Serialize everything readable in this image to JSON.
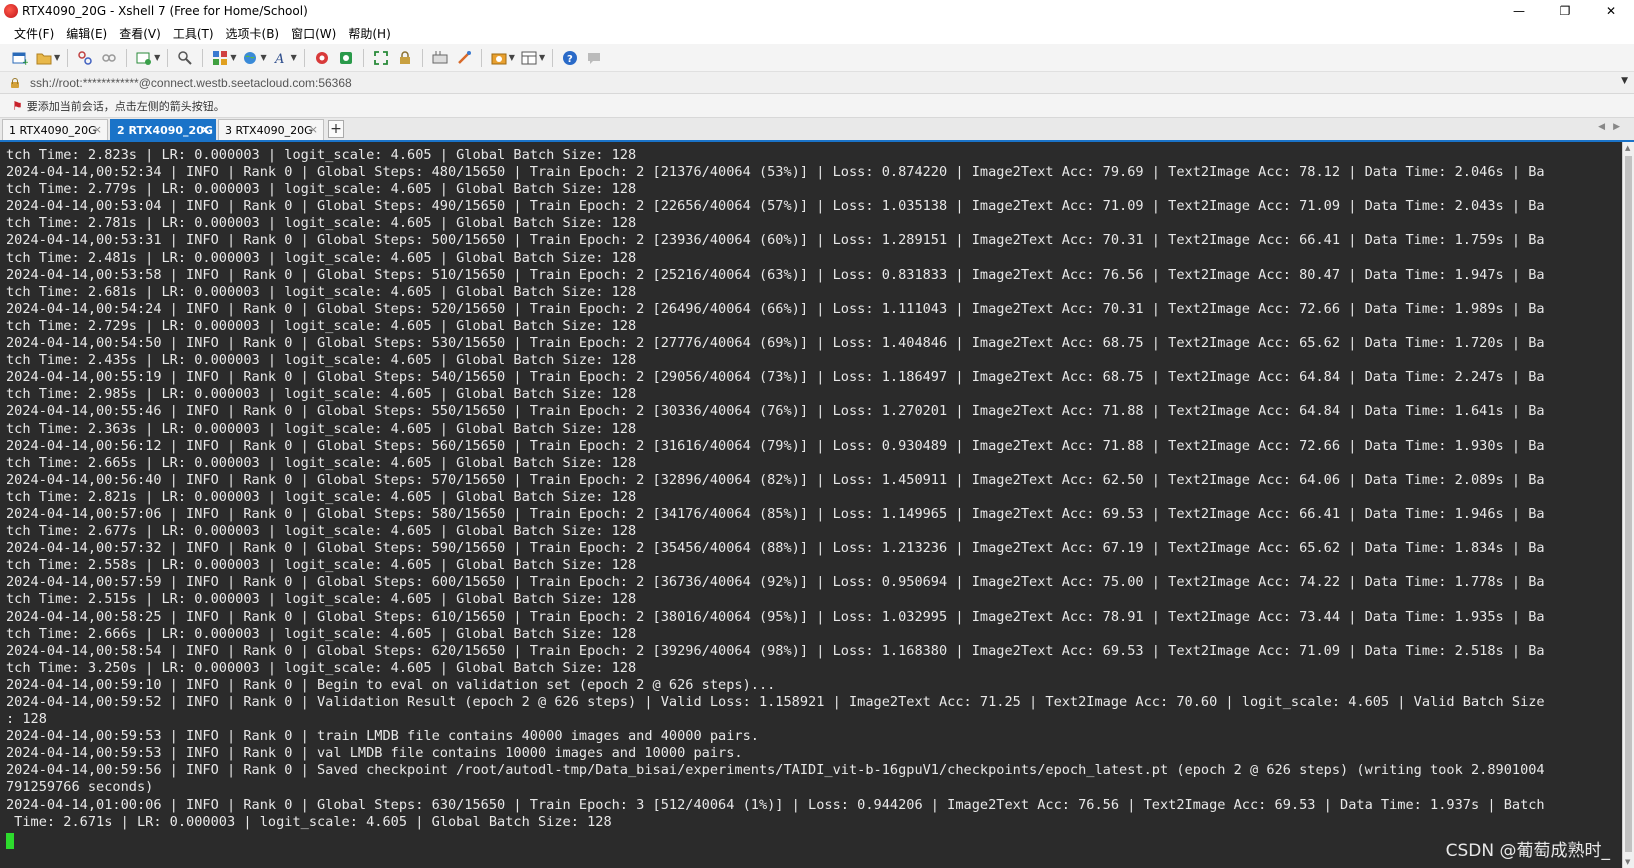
{
  "window": {
    "title": "RTX4090_20G - Xshell 7 (Free for Home/School)",
    "minimize": "—",
    "maximize": "❐",
    "close": "✕"
  },
  "menu": [
    "文件(F)",
    "编辑(E)",
    "查看(V)",
    "工具(T)",
    "选项卡(B)",
    "窗口(W)",
    "帮助(H)"
  ],
  "toolbar": {
    "icons": [
      "new-session-icon",
      "open-folder-icon",
      "connect-icon",
      "disconnect-icon",
      "reconnect-icon",
      "find-icon",
      "sessions-manager-icon",
      "globe-icon",
      "font-icon",
      "xftp-icon",
      "xmanager-icon",
      "fullscreen-icon",
      "lock-icon",
      "keyboard-icon",
      "script-icon",
      "capture-icon",
      "layout-icon",
      "help-icon",
      "chat-icon"
    ]
  },
  "address": {
    "url": "ssh://root:************@connect.westb.seetacloud.com:56368"
  },
  "hint": {
    "text": "要添加当前会话，点击左侧的箭头按钮。"
  },
  "tabs": [
    {
      "label": "1 RTX4090_20G",
      "close": "×"
    },
    {
      "label": "2 RTX4090_20G",
      "close": "×"
    },
    {
      "label": "3 RTX4090_20G",
      "close": "×"
    }
  ],
  "tab_add": "+",
  "terminal": {
    "lines": [
      "tch Time: 2.823s | LR: 0.000003 | logit_scale: 4.605 | Global Batch Size: 128",
      "2024-04-14,00:52:34 | INFO | Rank 0 | Global Steps: 480/15650 | Train Epoch: 2 [21376/40064 (53%)] | Loss: 0.874220 | Image2Text Acc: 79.69 | Text2Image Acc: 78.12 | Data Time: 2.046s | Ba",
      "tch Time: 2.779s | LR: 0.000003 | logit_scale: 4.605 | Global Batch Size: 128",
      "2024-04-14,00:53:04 | INFO | Rank 0 | Global Steps: 490/15650 | Train Epoch: 2 [22656/40064 (57%)] | Loss: 1.035138 | Image2Text Acc: 71.09 | Text2Image Acc: 71.09 | Data Time: 2.043s | Ba",
      "tch Time: 2.781s | LR: 0.000003 | logit_scale: 4.605 | Global Batch Size: 128",
      "2024-04-14,00:53:31 | INFO | Rank 0 | Global Steps: 500/15650 | Train Epoch: 2 [23936/40064 (60%)] | Loss: 1.289151 | Image2Text Acc: 70.31 | Text2Image Acc: 66.41 | Data Time: 1.759s | Ba",
      "tch Time: 2.481s | LR: 0.000003 | logit_scale: 4.605 | Global Batch Size: 128",
      "2024-04-14,00:53:58 | INFO | Rank 0 | Global Steps: 510/15650 | Train Epoch: 2 [25216/40064 (63%)] | Loss: 0.831833 | Image2Text Acc: 76.56 | Text2Image Acc: 80.47 | Data Time: 1.947s | Ba",
      "tch Time: 2.681s | LR: 0.000003 | logit_scale: 4.605 | Global Batch Size: 128",
      "2024-04-14,00:54:24 | INFO | Rank 0 | Global Steps: 520/15650 | Train Epoch: 2 [26496/40064 (66%)] | Loss: 1.111043 | Image2Text Acc: 70.31 | Text2Image Acc: 72.66 | Data Time: 1.989s | Ba",
      "tch Time: 2.729s | LR: 0.000003 | logit_scale: 4.605 | Global Batch Size: 128",
      "2024-04-14,00:54:50 | INFO | Rank 0 | Global Steps: 530/15650 | Train Epoch: 2 [27776/40064 (69%)] | Loss: 1.404846 | Image2Text Acc: 68.75 | Text2Image Acc: 65.62 | Data Time: 1.720s | Ba",
      "tch Time: 2.435s | LR: 0.000003 | logit_scale: 4.605 | Global Batch Size: 128",
      "2024-04-14,00:55:19 | INFO | Rank 0 | Global Steps: 540/15650 | Train Epoch: 2 [29056/40064 (73%)] | Loss: 1.186497 | Image2Text Acc: 68.75 | Text2Image Acc: 64.84 | Data Time: 2.247s | Ba",
      "tch Time: 2.985s | LR: 0.000003 | logit_scale: 4.605 | Global Batch Size: 128",
      "2024-04-14,00:55:46 | INFO | Rank 0 | Global Steps: 550/15650 | Train Epoch: 2 [30336/40064 (76%)] | Loss: 1.270201 | Image2Text Acc: 71.88 | Text2Image Acc: 64.84 | Data Time: 1.641s | Ba",
      "tch Time: 2.363s | LR: 0.000003 | logit_scale: 4.605 | Global Batch Size: 128",
      "2024-04-14,00:56:12 | INFO | Rank 0 | Global Steps: 560/15650 | Train Epoch: 2 [31616/40064 (79%)] | Loss: 0.930489 | Image2Text Acc: 71.88 | Text2Image Acc: 72.66 | Data Time: 1.930s | Ba",
      "tch Time: 2.665s | LR: 0.000003 | logit_scale: 4.605 | Global Batch Size: 128",
      "2024-04-14,00:56:40 | INFO | Rank 0 | Global Steps: 570/15650 | Train Epoch: 2 [32896/40064 (82%)] | Loss: 1.450911 | Image2Text Acc: 62.50 | Text2Image Acc: 64.06 | Data Time: 2.089s | Ba",
      "tch Time: 2.821s | LR: 0.000003 | logit_scale: 4.605 | Global Batch Size: 128",
      "2024-04-14,00:57:06 | INFO | Rank 0 | Global Steps: 580/15650 | Train Epoch: 2 [34176/40064 (85%)] | Loss: 1.149965 | Image2Text Acc: 69.53 | Text2Image Acc: 66.41 | Data Time: 1.946s | Ba",
      "tch Time: 2.677s | LR: 0.000003 | logit_scale: 4.605 | Global Batch Size: 128",
      "2024-04-14,00:57:32 | INFO | Rank 0 | Global Steps: 590/15650 | Train Epoch: 2 [35456/40064 (88%)] | Loss: 1.213236 | Image2Text Acc: 67.19 | Text2Image Acc: 65.62 | Data Time: 1.834s | Ba",
      "tch Time: 2.558s | LR: 0.000003 | logit_scale: 4.605 | Global Batch Size: 128",
      "2024-04-14,00:57:59 | INFO | Rank 0 | Global Steps: 600/15650 | Train Epoch: 2 [36736/40064 (92%)] | Loss: 0.950694 | Image2Text Acc: 75.00 | Text2Image Acc: 74.22 | Data Time: 1.778s | Ba",
      "tch Time: 2.515s | LR: 0.000003 | logit_scale: 4.605 | Global Batch Size: 128",
      "2024-04-14,00:58:25 | INFO | Rank 0 | Global Steps: 610/15650 | Train Epoch: 2 [38016/40064 (95%)] | Loss: 1.032995 | Image2Text Acc: 78.91 | Text2Image Acc: 73.44 | Data Time: 1.935s | Ba",
      "tch Time: 2.666s | LR: 0.000003 | logit_scale: 4.605 | Global Batch Size: 128",
      "2024-04-14,00:58:54 | INFO | Rank 0 | Global Steps: 620/15650 | Train Epoch: 2 [39296/40064 (98%)] | Loss: 1.168380 | Image2Text Acc: 69.53 | Text2Image Acc: 71.09 | Data Time: 2.518s | Ba",
      "tch Time: 3.250s | LR: 0.000003 | logit_scale: 4.605 | Global Batch Size: 128",
      "2024-04-14,00:59:10 | INFO | Rank 0 | Begin to eval on validation set (epoch 2 @ 626 steps)...",
      "2024-04-14,00:59:52 | INFO | Rank 0 | Validation Result (epoch 2 @ 626 steps) | Valid Loss: 1.158921 | Image2Text Acc: 71.25 | Text2Image Acc: 70.60 | logit_scale: 4.605 | Valid Batch Size",
      ": 128",
      "2024-04-14,00:59:53 | INFO | Rank 0 | train LMDB file contains 40000 images and 40000 pairs.",
      "2024-04-14,00:59:53 | INFO | Rank 0 | val LMDB file contains 10000 images and 10000 pairs.",
      "2024-04-14,00:59:56 | INFO | Rank 0 | Saved checkpoint /root/autodl-tmp/Data_bisai/experiments/TAIDI_vit-b-16gpuV1/checkpoints/epoch_latest.pt (epoch 2 @ 626 steps) (writing took 2.8901004",
      "791259766 seconds)",
      "2024-04-14,01:00:06 | INFO | Rank 0 | Global Steps: 630/15650 | Train Epoch: 3 [512/40064 (1%)] | Loss: 0.944206 | Image2Text Acc: 76.56 | Text2Image Acc: 69.53 | Data Time: 1.937s | Batch",
      " Time: 2.671s | LR: 0.000003 | logit_scale: 4.605 | Global Batch Size: 128"
    ]
  },
  "watermark": "CSDN @葡萄成熟时_"
}
